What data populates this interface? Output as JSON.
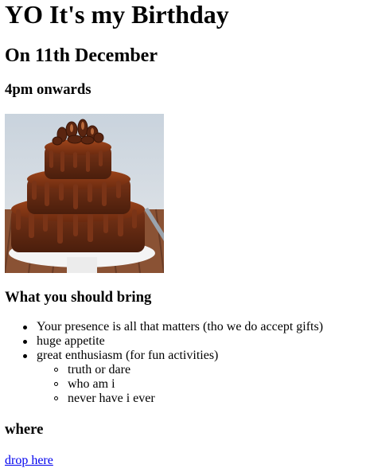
{
  "page": {
    "title": "YO It's my Birthday",
    "date": "On 11th December",
    "time": "4pm onwards"
  },
  "image": {
    "subject": "chocolate-cake"
  },
  "bring": {
    "heading": "What you should bring",
    "items": [
      "Your presence is all that matters (tho we do accept gifts)",
      "huge appetite",
      "great enthusiasm (for fun activities)"
    ],
    "activities": [
      "truth or dare",
      "who am i",
      "never have i ever"
    ]
  },
  "where": {
    "heading": "where",
    "link_text": "drop here"
  },
  "colors": {
    "link": "#0000ee",
    "text": "#000000",
    "background": "#ffffff"
  }
}
